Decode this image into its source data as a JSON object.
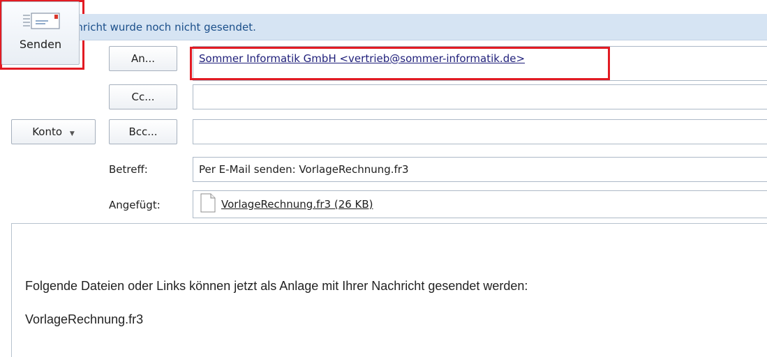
{
  "infobar": {
    "message": "Diese Nachricht wurde noch nicht gesendet."
  },
  "send_button": {
    "label": "Senden",
    "icon": "envelope-send-icon"
  },
  "account_button": {
    "label": "Konto",
    "icon": "chevron-down-icon"
  },
  "to": {
    "button_label": "An...",
    "value": "Sommer Informatik GmbH <vertrieb@sommer-informatik.de>"
  },
  "cc": {
    "button_label": "Cc...",
    "value": ""
  },
  "bcc": {
    "button_label": "Bcc...",
    "value": ""
  },
  "subject": {
    "label": "Betreff:",
    "value": "Per E-Mail senden: VorlageRechnung.fr3"
  },
  "attachment": {
    "label": "Angefügt:",
    "file": "VorlageRechnung.fr3 (26 KB)",
    "icon": "document-icon"
  },
  "body": {
    "line1": "Folgende Dateien oder Links können jetzt als Anlage mit Ihrer Nachricht gesendet werden:",
    "line2": "VorlageRechnung.fr3"
  },
  "colors": {
    "highlight": "#e21b23",
    "infobar": "#d6e4f3",
    "infobar_text": "#1b4f8a"
  }
}
